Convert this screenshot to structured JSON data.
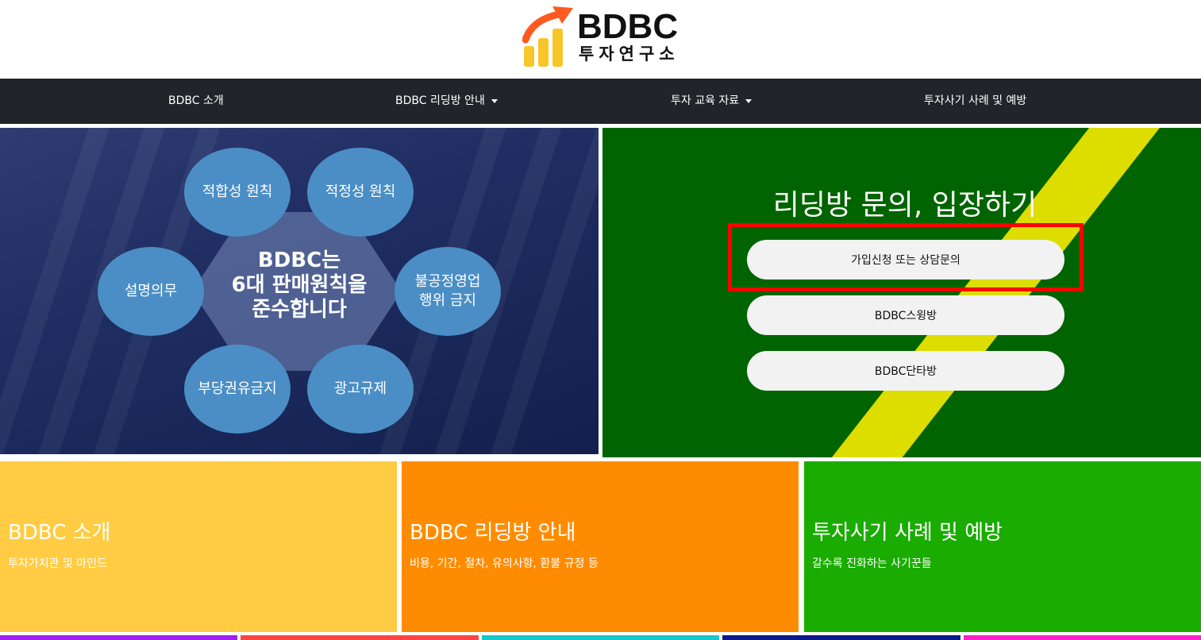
{
  "logo": {
    "title": "BDBC",
    "subtitle": "투자연구소",
    "colors": {
      "arrow": "#ff5a1f",
      "bars": "#f7c628"
    }
  },
  "nav": {
    "items": [
      {
        "label": "BDBC 소개",
        "dropdown": false
      },
      {
        "label": "BDBC 리딩방 안내",
        "dropdown": true
      },
      {
        "label": "투자 교육 자료",
        "dropdown": true
      },
      {
        "label": "투자사기 사례 및 예방",
        "dropdown": false
      }
    ]
  },
  "banner": {
    "center_lines": [
      "BDBC는",
      "6대 판매원칙을",
      "준수합니다"
    ],
    "principles": [
      "적합성 원칙",
      "적정성 원칙",
      "설명의무",
      "불공정영업\n행위 금지",
      "부당권유금지",
      "광고규제"
    ]
  },
  "join": {
    "title": "리딩방 문의, 입장하기",
    "buttons": [
      "가입신청 또는 상담문의",
      "BDBC스윙방",
      "BDBC단타방"
    ]
  },
  "tiles": [
    {
      "title": "BDBC 소개",
      "subtitle": "투자가치관 및 마인드",
      "color": "#ffcc44"
    },
    {
      "title": "BDBC 리딩방 안내",
      "subtitle": "비용, 기간, 절차, 유의사항, 환불 규정 등",
      "color": "#ff8c00"
    },
    {
      "title": "투자사기 사례 및 예방",
      "subtitle": "갈수록 진화하는 사기꾼들",
      "color": "#1aac00"
    }
  ],
  "bottom_strip_colors": [
    "#a020f0",
    "#ff4444",
    "#18c8c8",
    "#0a1a8a",
    "#ff22cc"
  ]
}
